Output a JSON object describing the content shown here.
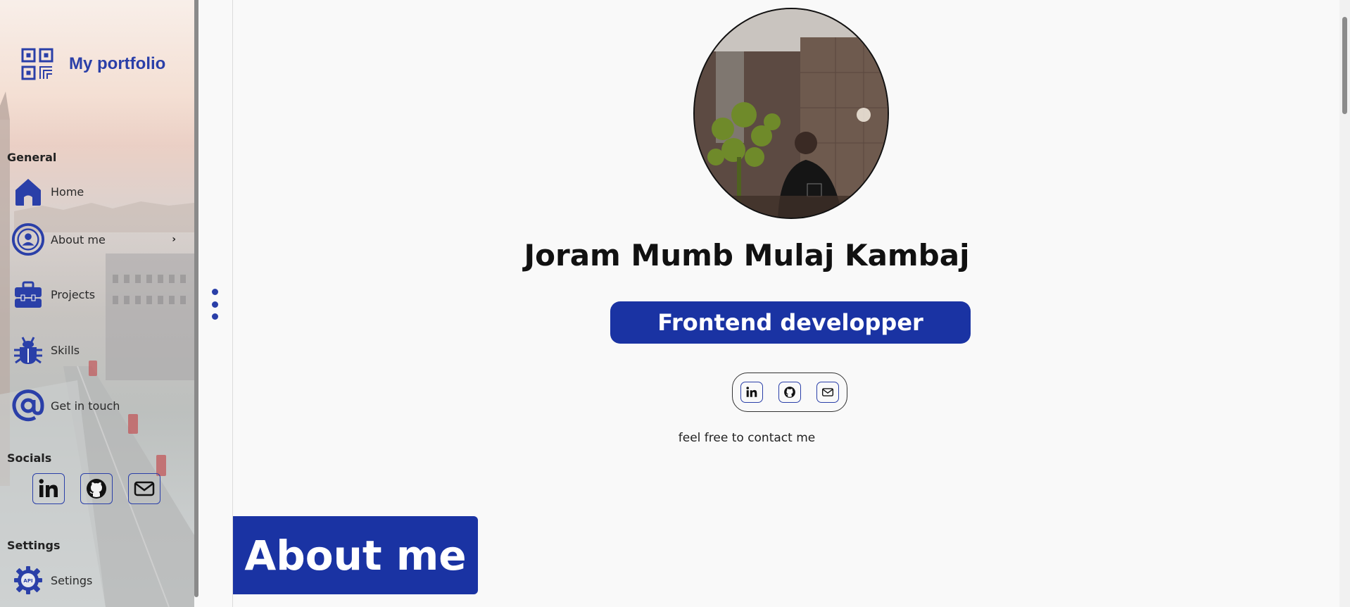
{
  "sidebar": {
    "brand_title": "My portfolio",
    "general_label": "General",
    "nav": {
      "home": "Home",
      "about": "About me",
      "projects": "Projects",
      "skills": "Skills",
      "contact": "Get in touch"
    },
    "socials_label": "Socials",
    "settings_label": "Settings",
    "settings_item": "Setings",
    "settings_icon_text": "API"
  },
  "main": {
    "name": "Joram Mumb Mulaj Kambaj",
    "role": "Frontend developper",
    "contact_note": "feel free to contact me",
    "section_title": "About me"
  },
  "colors": {
    "accent": "#1a33a3",
    "brand": "#2a3fa8"
  }
}
